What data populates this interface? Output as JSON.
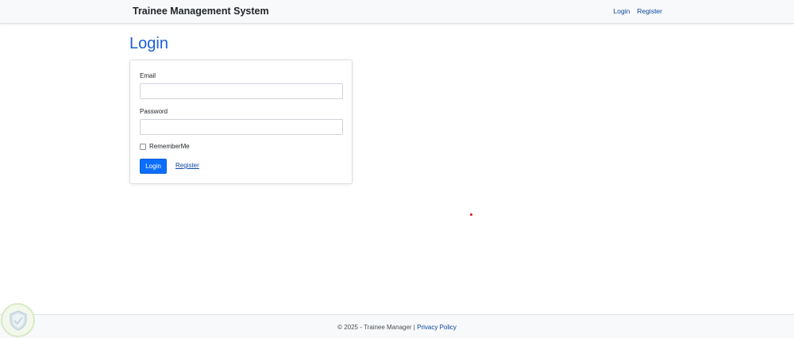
{
  "navbar": {
    "brand": "Trainee Management System",
    "links": [
      "Login",
      "Register"
    ]
  },
  "page": {
    "title": "Login"
  },
  "form": {
    "email_label": "Email",
    "email_value": "",
    "password_label": "Password",
    "password_value": "",
    "remember_label": "RememberMe",
    "remember_checked": false,
    "login_button": "Login",
    "register_link": "Register"
  },
  "footer": {
    "text": "© 2025 - Trainee Manager |",
    "privacy_link": "Privacy Policy"
  },
  "colors": {
    "primary": "#0d6efd",
    "title": "#1a5fd6",
    "link": "#0d47a1",
    "navbar_bg": "#f8f9fa",
    "dot": "#e01010"
  },
  "icons": {
    "corner_logo": "shield-icon"
  }
}
